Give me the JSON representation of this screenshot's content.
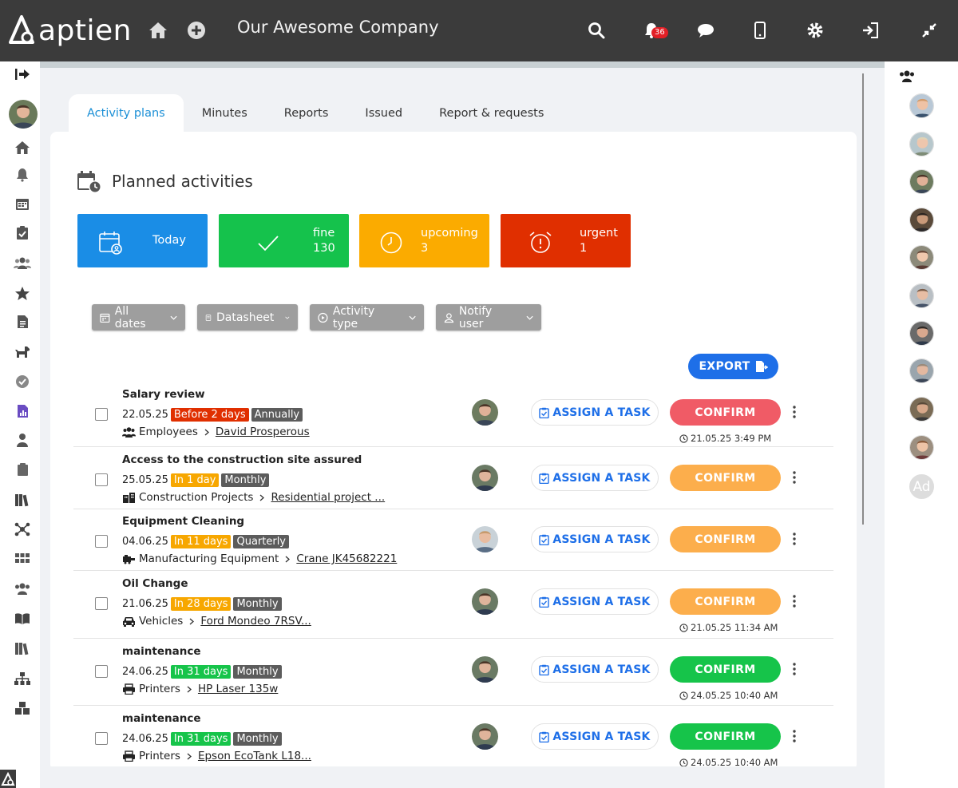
{
  "app": {
    "logo_text": "aptien",
    "company": "Our Awesome Company",
    "notifications_count": "36"
  },
  "tabs": [
    {
      "label": "Activity plans",
      "active": true
    },
    {
      "label": "Minutes",
      "active": false
    },
    {
      "label": "Reports",
      "active": false
    },
    {
      "label": "Issued",
      "active": false
    },
    {
      "label": "Report & requests",
      "active": false
    }
  ],
  "section": {
    "title": "Planned activities"
  },
  "stats": [
    {
      "label": "Today",
      "value": "",
      "color": "#1a8de6",
      "icon": "calendar-user-icon"
    },
    {
      "label": "fine",
      "value": "130",
      "color": "#15c24c",
      "icon": "check-icon"
    },
    {
      "label": "upcoming",
      "value": "3",
      "color": "#fbab00",
      "icon": "clock-icon"
    },
    {
      "label": "urgent",
      "value": "1",
      "color": "#e02f00",
      "icon": "alarm-icon"
    }
  ],
  "filters": [
    {
      "label": "All dates",
      "icon": "calendar-icon"
    },
    {
      "label": "Datasheet",
      "icon": "book-icon"
    },
    {
      "label": "Activity type",
      "icon": "play-circle-icon"
    },
    {
      "label": "Notify user",
      "icon": "user-icon"
    }
  ],
  "export_label": "EXPORT",
  "assign_label": "ASSIGN A TASK",
  "confirm_label": "CONFIRM",
  "activities": [
    {
      "title": "Salary review",
      "date": "22.05.25",
      "due": "Before 2 days",
      "due_color": "red",
      "period": "Annually",
      "category": "Employees",
      "category_icon": "users-icon",
      "target": "David Prosperous",
      "confirm_color": "red",
      "stamp": "21.05.25 3:49 PM"
    },
    {
      "title": "Access to the construction site assured",
      "date": "25.05.25",
      "due": "In 1 day",
      "due_color": "orange",
      "period": "Monthly",
      "category": "Construction Projects",
      "category_icon": "building-icon",
      "target": "Residential project ...",
      "confirm_color": "orange",
      "stamp": ""
    },
    {
      "title": "Equipment Cleaning",
      "date": "04.06.25",
      "due": "In 11 days",
      "due_color": "orange",
      "period": "Quarterly",
      "category": "Manufacturing Equipment",
      "category_icon": "machine-icon",
      "target": "Crane JK45682221",
      "confirm_color": "orange",
      "stamp": ""
    },
    {
      "title": "Oil Change",
      "date": "21.06.25",
      "due": "In 28 days",
      "due_color": "orange",
      "period": "Monthly",
      "category": "Vehicles",
      "category_icon": "car-icon",
      "target": "Ford Mondeo 7RSV...",
      "confirm_color": "orange",
      "stamp": "21.05.25 11:34 AM"
    },
    {
      "title": "maintenance",
      "date": "24.06.25",
      "due": "In 31 days",
      "due_color": "green",
      "period": "Monthly",
      "category": "Printers",
      "category_icon": "printer-icon",
      "target": "HP Laser 135w",
      "confirm_color": "green",
      "stamp": "24.05.25 10:40 AM"
    },
    {
      "title": "maintenance",
      "date": "24.06.25",
      "due": "In 31 days",
      "due_color": "green",
      "period": "Monthly",
      "category": "Printers",
      "category_icon": "printer-icon",
      "target": "Epson EcoTank L18...",
      "confirm_color": "green",
      "stamp": "24.05.25 10:40 AM"
    }
  ],
  "right_sidebar": {
    "last_avatar_initials": "Ad"
  }
}
